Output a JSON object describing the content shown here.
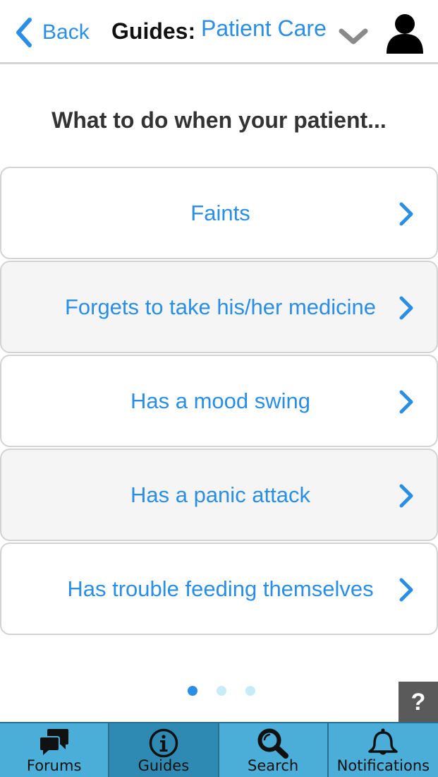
{
  "colors": {
    "accent": "#2a8ee6",
    "tab_bg": "#4aaed8",
    "tab_active_bg": "#2e8ab3",
    "dot_active": "#2a8ee6",
    "dot_inactive": "#c6ecf7",
    "help_bg": "#5a5a5a"
  },
  "header": {
    "back_label": "Back",
    "back_icon": "chevron-left-icon",
    "title_prefix": "Guides:",
    "category": "Patient Care",
    "dropdown_icon": "chevron-down-icon",
    "profile_icon": "user-icon"
  },
  "main": {
    "heading": "What to do when your patient...",
    "items": [
      {
        "label": "Faints"
      },
      {
        "label": "Forgets to take his/her medicine"
      },
      {
        "label": "Has a mood swing"
      },
      {
        "label": "Has a panic attack"
      },
      {
        "label": "Has trouble feeding themselves"
      }
    ]
  },
  "pager": {
    "count": 3,
    "current": 1
  },
  "help": {
    "label": "?"
  },
  "tabbar": {
    "active": "Guides",
    "tabs": [
      {
        "label": "Forums",
        "icon": "chat-bubbles-icon"
      },
      {
        "label": "Guides",
        "icon": "info-icon"
      },
      {
        "label": "Search",
        "icon": "search-icon"
      },
      {
        "label": "Notifications",
        "icon": "bell-icon"
      }
    ]
  }
}
